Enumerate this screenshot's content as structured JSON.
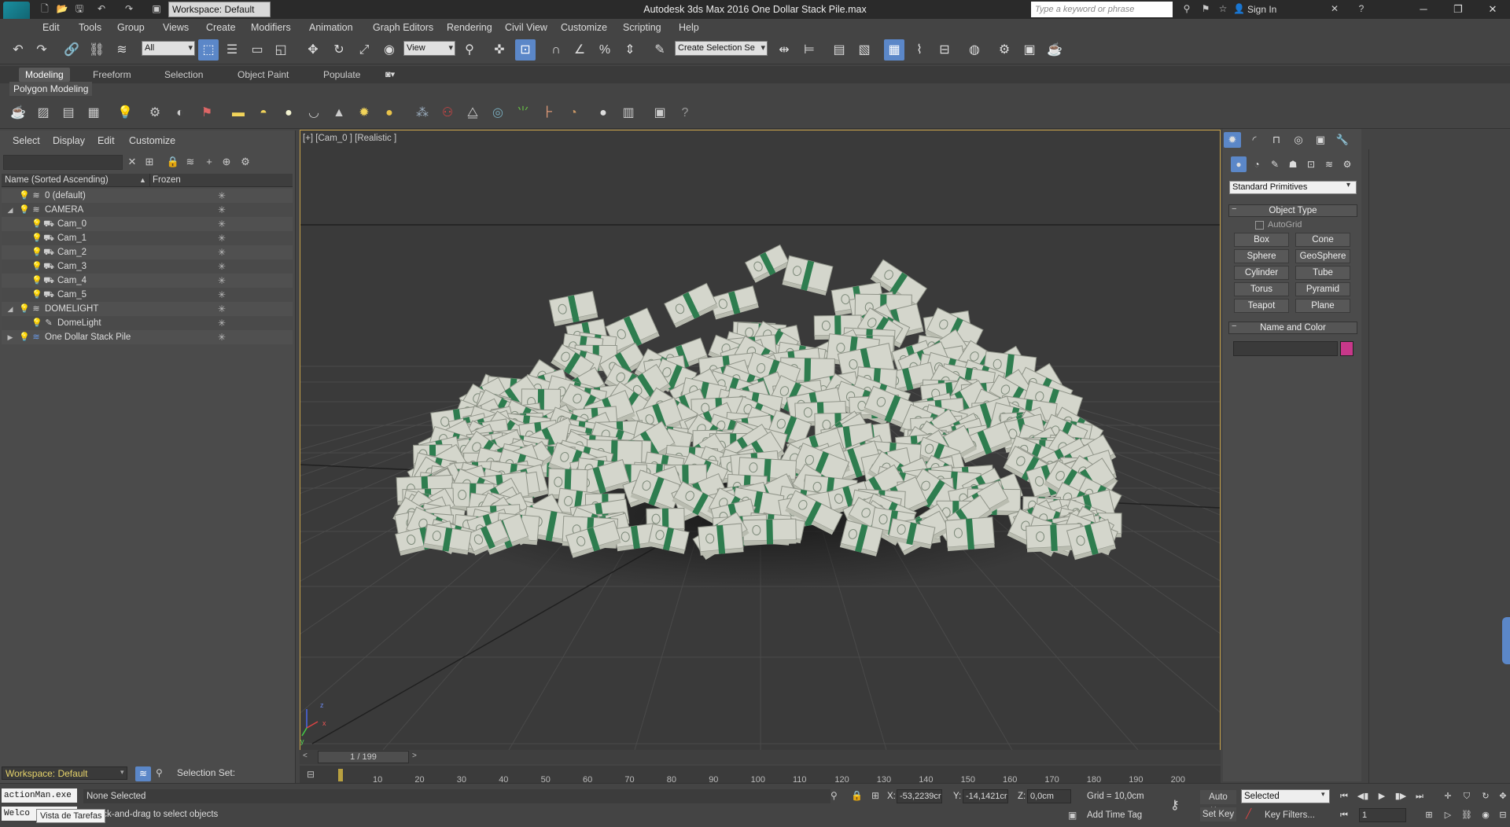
{
  "titlebar": {
    "app_title": "Autodesk 3ds Max 2016    One Dollar Stack Pile.max",
    "workspace": "Workspace: Default",
    "search_placeholder": "Type a keyword or phrase",
    "sign_in": "Sign In",
    "logo": "MAX"
  },
  "menus": [
    "Edit",
    "Tools",
    "Group",
    "Views",
    "Create",
    "Modifiers",
    "Animation",
    "Graph Editors",
    "Rendering",
    "Civil View",
    "Customize",
    "Scripting",
    "Help"
  ],
  "toolbar": {
    "selection_filter": "All",
    "ref_coord": "View",
    "named_selection": "Create Selection Se"
  },
  "ribbon": {
    "tabs": [
      "Modeling",
      "Freeform",
      "Selection",
      "Object Paint",
      "Populate"
    ],
    "panel": "Polygon Modeling"
  },
  "explorer": {
    "menus": [
      "Select",
      "Display",
      "Edit",
      "Customize"
    ],
    "col_name": "Name (Sorted Ascending)",
    "col_frozen": "Frozen",
    "rows": [
      {
        "name": "0 (default)",
        "depth": 0,
        "kind": "layer"
      },
      {
        "name": "CAMERA",
        "depth": 0,
        "kind": "layer",
        "expanded": true
      },
      {
        "name": "Cam_0",
        "depth": 1,
        "kind": "camera"
      },
      {
        "name": "Cam_1",
        "depth": 1,
        "kind": "camera"
      },
      {
        "name": "Cam_2",
        "depth": 1,
        "kind": "camera"
      },
      {
        "name": "Cam_3",
        "depth": 1,
        "kind": "camera"
      },
      {
        "name": "Cam_4",
        "depth": 1,
        "kind": "camera"
      },
      {
        "name": "Cam_5",
        "depth": 1,
        "kind": "camera"
      },
      {
        "name": "DOMELIGHT",
        "depth": 0,
        "kind": "layer",
        "expanded": true
      },
      {
        "name": "DomeLight",
        "depth": 1,
        "kind": "light"
      },
      {
        "name": "One Dollar Stack Pile",
        "depth": 0,
        "kind": "layer-blue",
        "expanded": false
      }
    ]
  },
  "viewport": {
    "label": "[+] [Cam_0 ] [Realistic ]",
    "axis_z": "z",
    "axis_x": "x",
    "axis_y": "y"
  },
  "command_panel": {
    "primitive_type": "Standard Primitives",
    "object_type_title": "Object Type",
    "autogrid": "AutoGrid",
    "buttons": [
      "Box",
      "Cone",
      "Sphere",
      "GeoSphere",
      "Cylinder",
      "Tube",
      "Torus",
      "Pyramid",
      "Teapot",
      "Plane"
    ],
    "name_color_title": "Name and Color",
    "swatch_color": "#c8388a"
  },
  "timeline": {
    "frame_label": "1 / 199",
    "ticks": [
      "10",
      "20",
      "30",
      "40",
      "50",
      "60",
      "70",
      "80",
      "90",
      "100",
      "110",
      "120",
      "130",
      "140",
      "150",
      "160",
      "170",
      "180",
      "190",
      "200"
    ]
  },
  "status": {
    "workspace": "Workspace: Default",
    "selection_set": "Selection Set:",
    "script_line1": "actionMan.exe",
    "script_line2": "Welco",
    "tooltip": "Vista de Tarefas",
    "none_selected": "None Selected",
    "prompt": "or click-and-drag to select objects",
    "x_label": "X:",
    "x_value": "-53,2239cr",
    "y_label": "Y:",
    "y_value": "-14,1421cr",
    "z_label": "Z:",
    "z_value": "0,0cm",
    "grid": "Grid = 10,0cm",
    "add_time_tag": "Add Time Tag",
    "auto_key": "Auto Key",
    "set_key": "Set Key",
    "key_mode": "Selected",
    "key_filters": "Key Filters...",
    "frame": "1"
  },
  "colors": {
    "accent": "#5b87c8",
    "viewport_border": "#c8a34b",
    "bill_green": "#2e7d4f",
    "bill_paper": "#d4d6cc"
  }
}
